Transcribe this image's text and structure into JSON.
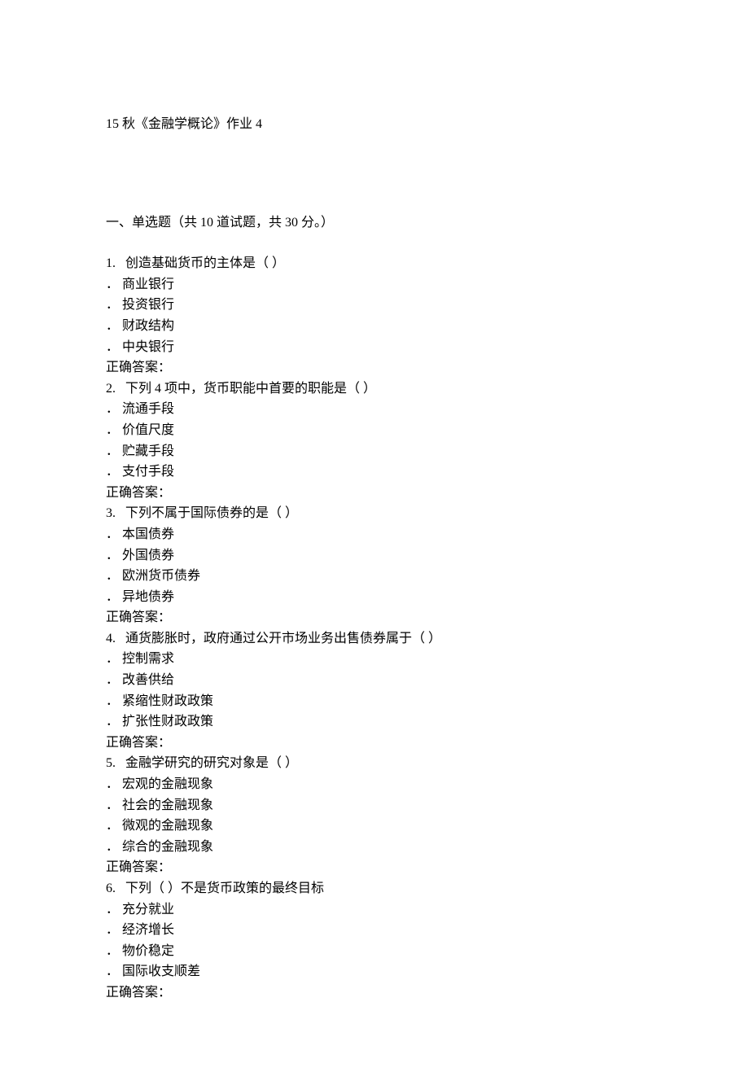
{
  "title": "15 秋《金融学概论》作业 4",
  "section": {
    "heading": "一、单选题（共 10 道试题，共 30 分。）"
  },
  "questions": [
    {
      "num": "1.",
      "text": "创造基础货币的主体是（ ）",
      "options": [
        "． 商业银行",
        "． 投资银行",
        "． 财政结构",
        "． 中央银行"
      ],
      "answer": "正确答案："
    },
    {
      "num": "2.",
      "text": "下列 4 项中，货币职能中首要的职能是（ ）",
      "options": [
        "． 流通手段",
        "． 价值尺度",
        "． 贮藏手段",
        "． 支付手段"
      ],
      "answer": "正确答案："
    },
    {
      "num": "3.",
      "text": "下列不属于国际债券的是（ ）",
      "options": [
        "． 本国债券",
        "． 外国债券",
        "． 欧洲货币债券",
        "． 异地债券"
      ],
      "answer": "正确答案："
    },
    {
      "num": "4.",
      "text": "通货膨胀时，政府通过公开市场业务出售债券属于（ ）",
      "options": [
        "． 控制需求",
        "． 改善供给",
        "． 紧缩性财政政策",
        "． 扩张性财政政策"
      ],
      "answer": "正确答案："
    },
    {
      "num": "5.",
      "text": "金融学研究的研究对象是（ ）",
      "options": [
        "． 宏观的金融现象",
        "． 社会的金融现象",
        "． 微观的金融现象",
        "． 综合的金融现象"
      ],
      "answer": "正确答案："
    },
    {
      "num": "6.",
      "text": "下列（ ）不是货币政策的最终目标",
      "options": [
        "． 充分就业",
        "． 经济增长",
        "． 物价稳定",
        "． 国际收支顺差"
      ],
      "answer": "正确答案："
    }
  ]
}
